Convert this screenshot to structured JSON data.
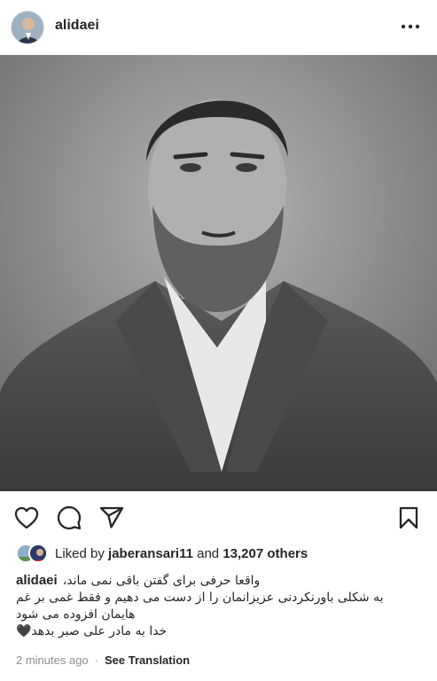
{
  "post": {
    "username": "alidaei",
    "more_icon": "more-horizontal-icon",
    "photo_description": "black-and-white portrait"
  },
  "actions": {
    "like_icon": "heart-icon",
    "comment_icon": "comment-icon",
    "share_icon": "send-icon",
    "save_icon": "bookmark-icon"
  },
  "likes": {
    "prefix": "Liked by",
    "user": "jaberansari11",
    "joiner": "and",
    "count": "13,207 others"
  },
  "caption": {
    "username": "alidaei",
    "line1": "واقعا حرفی برای گفتن باقی نمی ماند،",
    "line2": "به شکلی باورنکردنی عزیزانمان را از دست می دهیم و فقط غمی بر غم",
    "line3": "هایمان افزوده می شود",
    "line4": "خدا به مادر علی صبر بدهد🖤"
  },
  "meta": {
    "time": "2 minutes ago",
    "separator": "·",
    "translate": "See Translation"
  }
}
